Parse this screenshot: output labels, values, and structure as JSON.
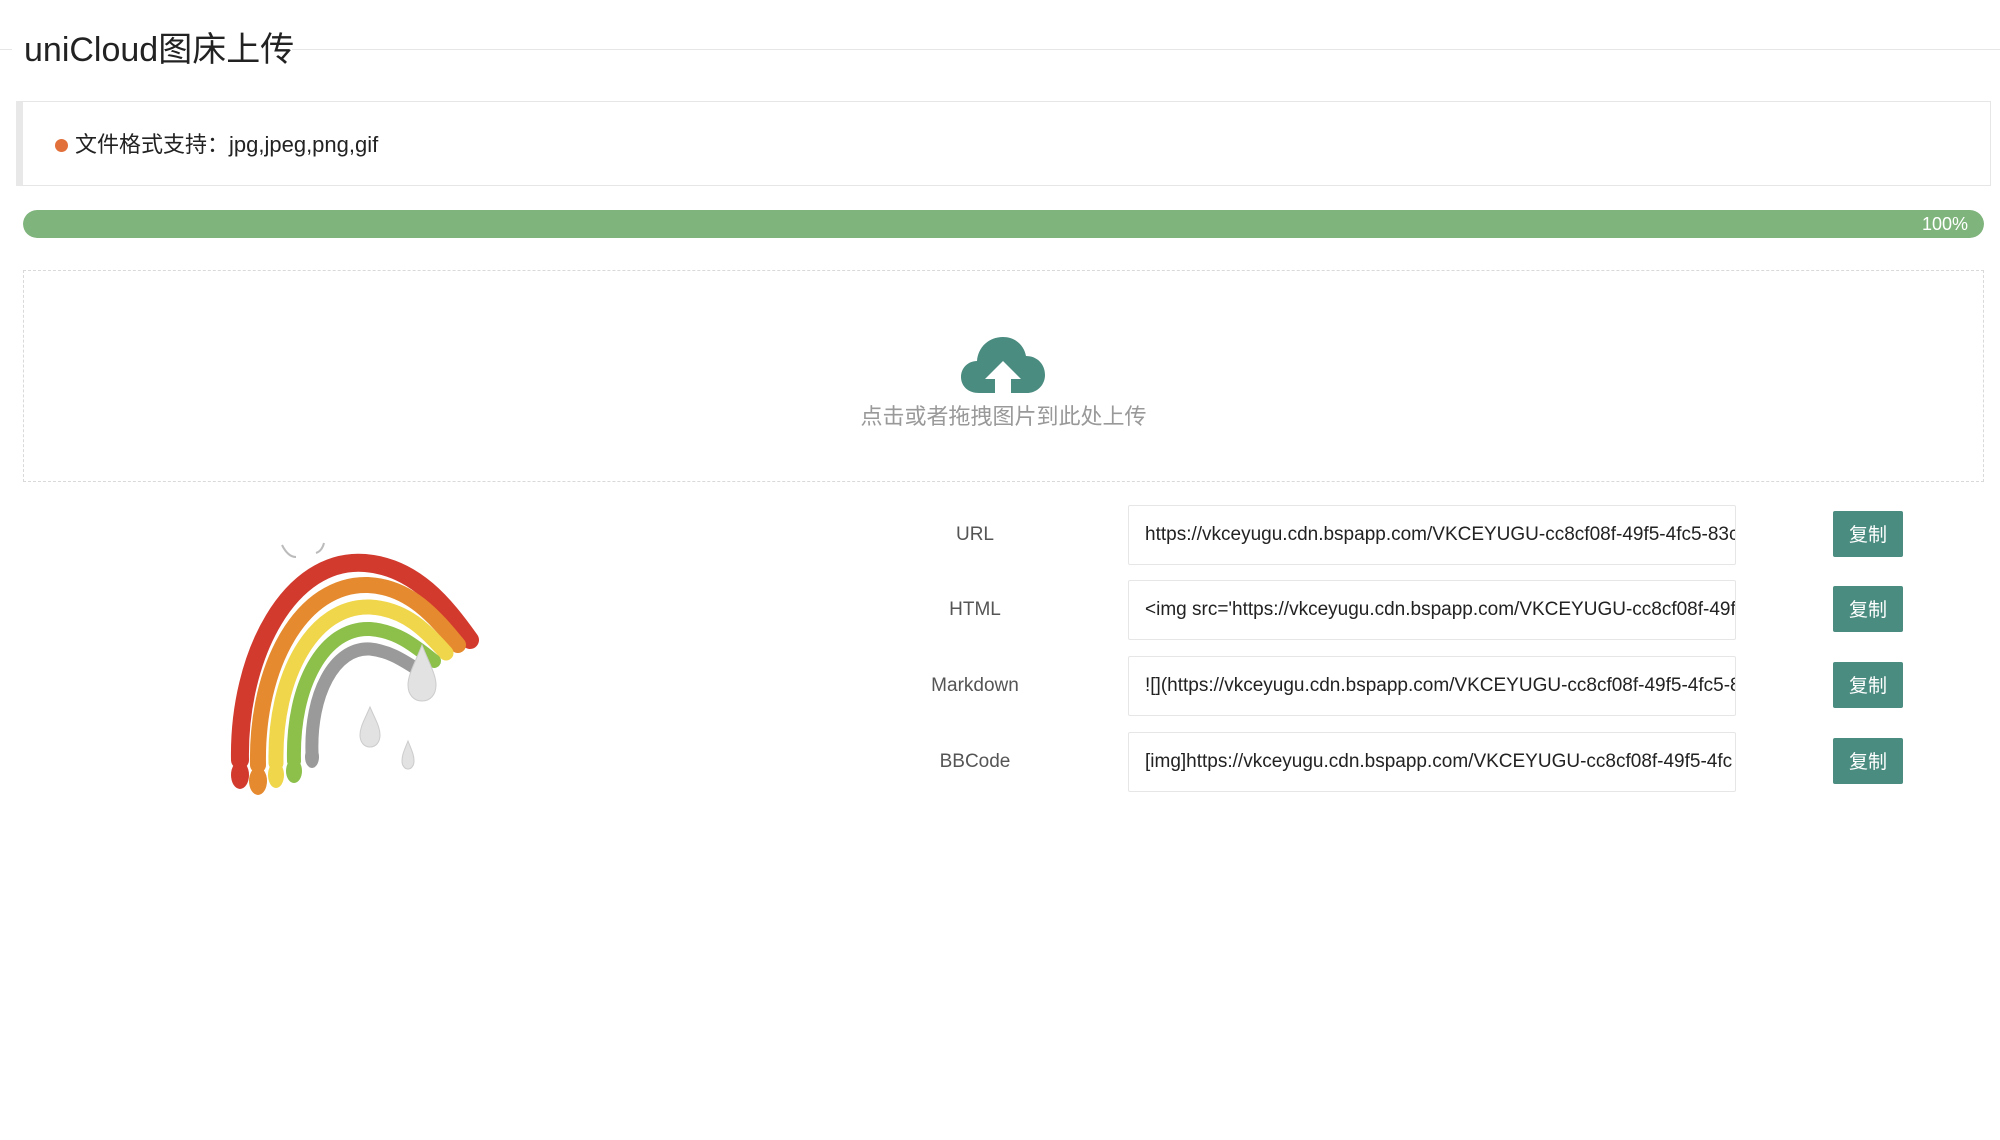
{
  "header": {
    "title": "uniCloud图床上传"
  },
  "notice": {
    "text": "文件格式支持：jpg,jpeg,png,gif",
    "dot_color": "#e2703a"
  },
  "progress": {
    "value": 1.0,
    "label": "100%",
    "color": "#7fb57c"
  },
  "dropzone": {
    "icon": "cloud-upload-icon",
    "text": "点击或者拖拽图片到此处上传",
    "icon_color": "#4a8c80"
  },
  "preview": {
    "icon": "rainbow-image"
  },
  "results": [
    {
      "label": "URL",
      "value": "https://vkceyugu.cdn.bspapp.com/VKCEYUGU-cc8cf08f-49f5-4fc5-83c",
      "button": "复制"
    },
    {
      "label": "HTML",
      "value": "<img src='https://vkceyugu.cdn.bspapp.com/VKCEYUGU-cc8cf08f-49f",
      "button": "复制"
    },
    {
      "label": "Markdown",
      "value": "![](https://vkceyugu.cdn.bspapp.com/VKCEYUGU-cc8cf08f-49f5-4fc5-8",
      "button": "复制"
    },
    {
      "label": "BBCode",
      "value": "[img]https://vkceyugu.cdn.bspapp.com/VKCEYUGU-cc8cf08f-49f5-4fc",
      "button": "复制"
    }
  ],
  "theme": {
    "button_color": "#4a8c80"
  }
}
